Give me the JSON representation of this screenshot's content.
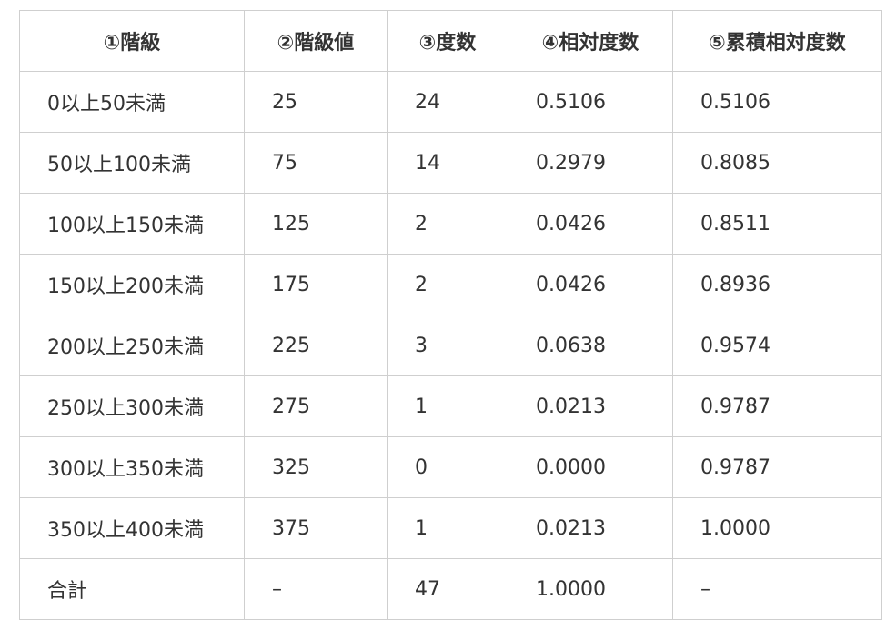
{
  "table": {
    "headers": [
      "①階級",
      "②階級値",
      "③度数",
      "④相対度数",
      "⑤累積相対度数"
    ],
    "rows": [
      [
        "0以上50未満",
        "25",
        "24",
        "0.5106",
        "0.5106"
      ],
      [
        "50以上100未満",
        "75",
        "14",
        "0.2979",
        "0.8085"
      ],
      [
        "100以上150未満",
        "125",
        "2",
        "0.0426",
        "0.8511"
      ],
      [
        "150以上200未満",
        "175",
        "2",
        "0.0426",
        "0.8936"
      ],
      [
        "200以上250未満",
        "225",
        "3",
        "0.0638",
        "0.9574"
      ],
      [
        "250以上300未満",
        "275",
        "1",
        "0.0213",
        "0.9787"
      ],
      [
        "300以上350未満",
        "325",
        "0",
        "0.0000",
        "0.9787"
      ],
      [
        "350以上400未満",
        "375",
        "1",
        "0.0213",
        "1.0000"
      ],
      [
        "合計",
        "–",
        "47",
        "1.0000",
        "–"
      ]
    ]
  }
}
